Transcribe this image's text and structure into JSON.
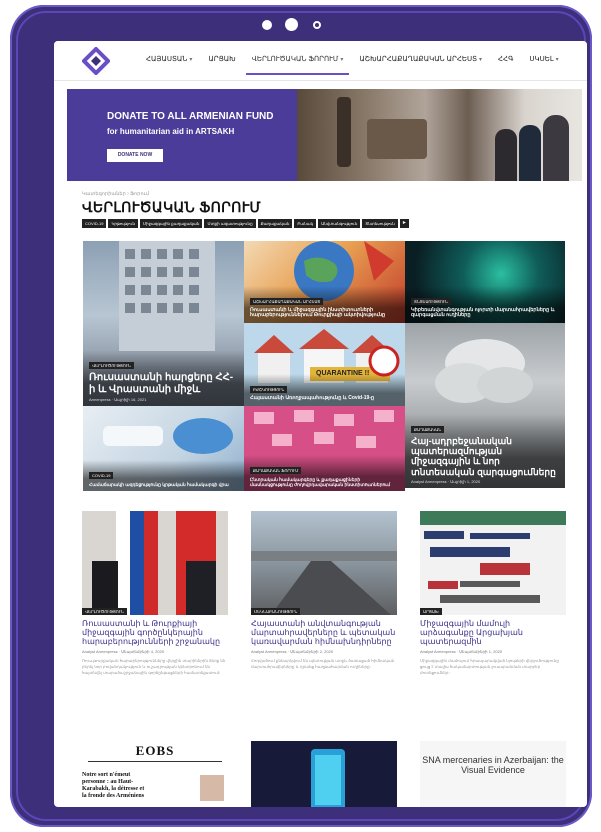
{
  "header": {
    "nav": [
      {
        "label": "ՀԱՅԱՍՏԱՆ",
        "caret": true,
        "active": false
      },
      {
        "label": "ԱՐՑԱԽ",
        "caret": false,
        "active": false
      },
      {
        "label": "ՎԵՐԼՈՒԾԱԿԱՆ ՖՈՐՈՒՄ",
        "caret": true,
        "active": true
      },
      {
        "label": "ԱՇԽԱՐՀԱՔԱՂԱՔԱԿԱՆ ԱՐՀԵՍՏ",
        "caret": true,
        "active": false
      },
      {
        "label": "ՀՀԳ",
        "caret": false,
        "active": false
      },
      {
        "label": "ՍԿՍԵԼ",
        "caret": true,
        "active": false
      }
    ]
  },
  "banner": {
    "title_prefix": "DONATE TO ",
    "title_accent": "ALL ARMENIAN FUND",
    "subtitle": "for humanitarian aid in ARTSAKH",
    "button": "DONATE NOW"
  },
  "section": {
    "crumb": "Կատեգորիաներ › Ֆորում",
    "title": "ՎԵՐԼՈՒԾԱԿԱՆ ՖՈՐՈՒՄ",
    "tags": [
      "COVID-19",
      "Կրթություն",
      "Միջազգային քաղաքական",
      "Մտքի ազատությունը",
      "Քաղաքական",
      "Բանակ",
      "Անվտանգություն",
      "Տնտեսություն"
    ],
    "more": "▸"
  },
  "mosaic": [
    {
      "cat": "ՎԵՐԼՈՒԾՈՒԹՅՈՒՆ",
      "title": "Ռուսաստանի հարցերը ՀՀ-ի և Վրաստանի միջև",
      "meta": "Armenpress · Ապրիլի 16, 2021"
    },
    {
      "cat": "ԱՇԽԱՐՀԱՔԱՂԱՔԱԿԱՆ ԱՐՀԵՍՏ",
      "title": "Ռուսաստանի և միջազգային ինստիտուտների հարաբերություններում Թուրքիայի ակտիվությունը",
      "meta": ""
    },
    {
      "cat": "ՏՆՏԵՍՈՒԹՅՈՒՆ",
      "title": "Կիբեռանվտանգության ոլորտի մարտահրավերները և զարգացման ուղիները",
      "meta": ""
    },
    {
      "cat": "ԲԺՇԿՈՒԹՅՈՒՆ",
      "title": "Հայաստանի Առողջապահությունը և Covid-19-ը",
      "meta": ""
    },
    {
      "cat": "ՔԱՂԱՔԱԿԱՆ",
      "title": "Հայ-ադրբեջանական պատերազմության միջազգային և նոր տնտեսական զարգացումները",
      "meta": "Analyst Armenpress · Ապրիլի 1, 2020"
    },
    {
      "cat": "COVID-19",
      "title": "Համաճարակի ազդեցությունը կրթական համակարգի վրա",
      "meta": ""
    },
    {
      "cat": "ՔԱՂԱՔԱԿԱՆ ՖՈՐՈՒՄ",
      "title": "Ընտրական համակարգերը և քաղաքացիների մասնակցությունը ժողովրդավարական ինստիտուտներում",
      "meta": ""
    }
  ],
  "quarantine_sign": "QUARANTINE !!",
  "cards": [
    {
      "cat": "ՎԵՐԼՈՒԾՈՒԹՅՈՒՆ",
      "title": "Ռուսաստանի և Թուրքիայի միջազգային գործընկերային հարաբերությունների շրջանակը",
      "meta": "Analyst Armenpress · Սեպտեմբերի 4, 2020",
      "excerpt": "Ռուս-թուրքական հարաբերությունները վերջին տարիներին ձեռք են բերել նոր բովանդակություն և ուշադրության կենտրոնում են հայտնվել տարածաշրջանային գործընթացների համատեքստում։"
    },
    {
      "cat": "ՄԵԿՆԱԲԱՆՈՒԹՅՈՒՆ",
      "title": "Հայաստանի անվտանգության մարտահրավերները և պետական կառավարման հիմնախնդիրները",
      "meta": "Analyst Armenpress · Սեպտեմբերի 2, 2020",
      "excerpt": "Հոդվածում քննարկվում են պետության առջև ծառացած հիմնական մարտահրավերները և դրանց հաղթահարման ուղիները։"
    },
    {
      "cat": "ԱՐՑԱԽ",
      "title": "Միջազգային մամուլի արձագանքը Արցախյան պատերազմին",
      "meta": "Analyst Armenpress · Սեպտեմբերի 1, 2020",
      "excerpt": "Միջազգային մամուլում հրապարակված նյութերի վերլուծությունը ցույց է տալիս հակամարտության լուսաբանման տարբեր մոտեցումներ։"
    }
  ],
  "bottom": {
    "eobs_logo": "EOBS",
    "eobs_text": "Notre sort n'émeut\npersonne : au Haut-\nKarabakh, la détresse et\nla fronde des Arméniens",
    "snav_text": "SNA mercenaries in Azerbaijan: the Visual Evidence"
  },
  "colors": {
    "frame": "#3d2f7a",
    "accent": "#6a4fc6",
    "card_title": "#3a2f86"
  }
}
